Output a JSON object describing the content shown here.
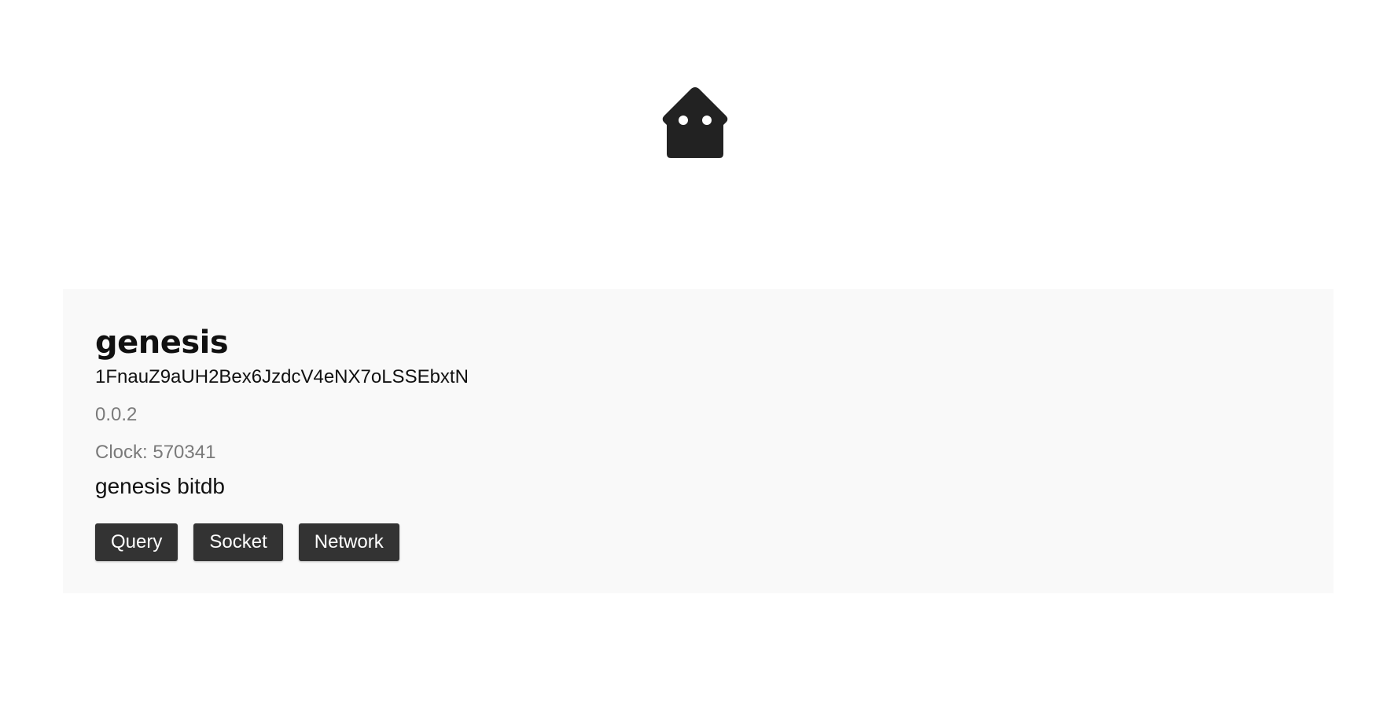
{
  "header": {
    "logo_icon": "house-face-icon",
    "logo_color": "#222222"
  },
  "app": {
    "title": "genesis",
    "address": "1FnauZ9aUH2Bex6JzdcV4eNX7oLSSEbxtN",
    "version": "0.0.2",
    "clock": "Clock: 570341",
    "description": "genesis bitdb",
    "buttons": {
      "query_label": "Query",
      "socket_label": "Socket",
      "network_label": "Network"
    }
  },
  "colors": {
    "card_background": "#f9f9f9",
    "button_background": "#333333",
    "button_text": "#ffffff",
    "muted_text": "#7a7a7a"
  }
}
